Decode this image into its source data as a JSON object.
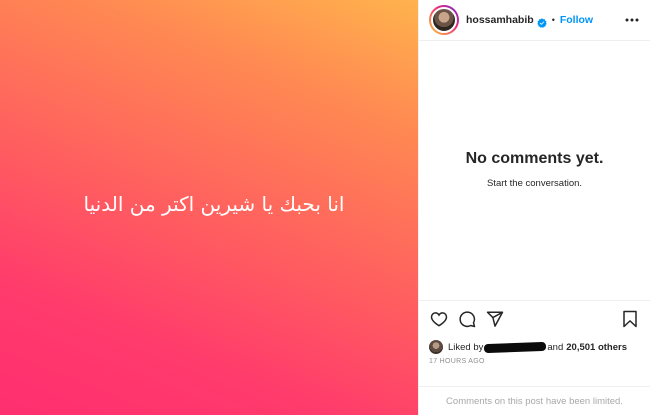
{
  "post": {
    "caption_text": "انا بحبك يا شيرين اكتر من الدنيا",
    "gradient_colors": [
      "#ffb34d",
      "#ff8a52",
      "#ff5f5f",
      "#ff3a6c",
      "#ff2f70"
    ]
  },
  "header": {
    "username": "hossamhabib",
    "verified_icon": "verified-badge-icon",
    "separator": "•",
    "follow_label": "Follow",
    "more_icon": "more-options-icon",
    "accent": "#0095f6"
  },
  "comments": {
    "empty_title": "No comments yet.",
    "empty_subtitle": "Start the conversation."
  },
  "actions": {
    "icons": [
      "heart-icon",
      "comment-icon",
      "share-icon",
      "bookmark-icon"
    ]
  },
  "likes": {
    "prefix": "Liked by",
    "middle": "and",
    "count_text": "20,501 others"
  },
  "timestamp": "17 HOURS AGO",
  "footer": {
    "limited_text": "Comments on this post have been limited."
  }
}
